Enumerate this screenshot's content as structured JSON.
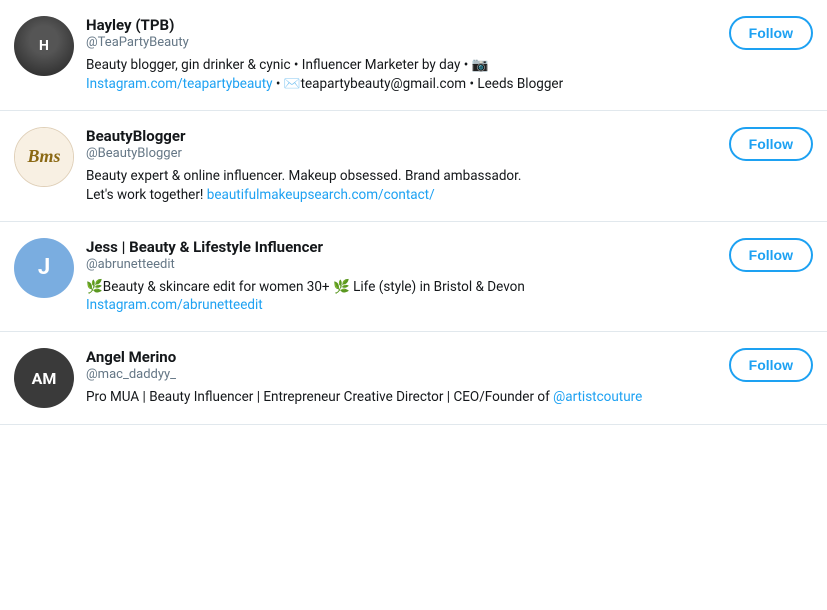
{
  "users": [
    {
      "id": "hayley",
      "display_name": "Hayley (TPB)",
      "screen_name": "@TeaPartyBeauty",
      "bio_text": "Beauty blogger, gin drinker & cynic • Influencer Marketer by day • 📷",
      "bio_link_text": "Instagram.com/teapartybeauty",
      "bio_link_href": "http://Instagram.com/teapartybeauty",
      "bio_suffix": " • ✉️teapartybeauty@gmail.com • Leeds Blogger",
      "follow_label": "Follow",
      "avatar_label": "H",
      "avatar_class": "avatar-1"
    },
    {
      "id": "beautyblogger",
      "display_name": "BeautyBlogger",
      "screen_name": "@BeautyBlogger",
      "bio_text": "Beauty expert & online influencer. Makeup obsessed. Brand ambassador. Let's work together! ",
      "bio_link_text": "beautifulmakeupsearch.com/contact/",
      "bio_link_href": "http://beautifulmakeupsearch.com/contact/",
      "bio_suffix": "",
      "follow_label": "Follow",
      "avatar_label": "Bms",
      "avatar_class": "avatar-2"
    },
    {
      "id": "jess",
      "display_name": "Jess | Beauty & Lifestyle Influencer",
      "screen_name": "@abrunetteedit",
      "bio_text": "🌿Beauty & skincare edit for women 30+ 🌿 Life (style) in Bristol & Devon",
      "bio_link_text": "Instagram.com/abrunetteedit",
      "bio_link_href": "http://Instagram.com/abrunetteedit",
      "bio_suffix": "",
      "follow_label": "Follow",
      "avatar_label": "J",
      "avatar_class": "avatar-3"
    },
    {
      "id": "angel",
      "display_name": "Angel Merino",
      "screen_name": "@mac_daddyy_",
      "bio_text": "Pro MUA | Beauty Influencer | Entrepreneur Creative Director | CEO/Founder of ",
      "bio_link_text": "@artistcouture",
      "bio_link_href": "http://twitter.com/artistcouture",
      "bio_suffix": "",
      "follow_label": "Follow",
      "avatar_label": "AM",
      "avatar_class": "avatar-4"
    }
  ]
}
